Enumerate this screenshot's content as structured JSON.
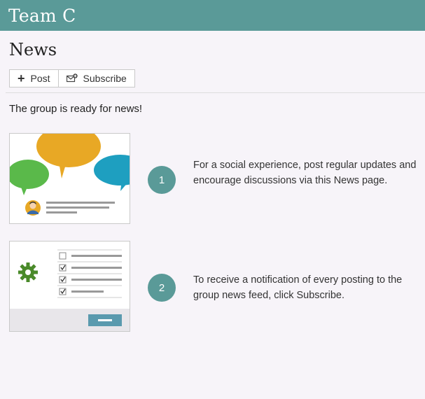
{
  "header": {
    "title": "Team C"
  },
  "page": {
    "title": "News"
  },
  "toolbar": {
    "post_label": "Post",
    "subscribe_label": "Subscribe"
  },
  "intro_text": "The group is ready for news!",
  "steps": [
    {
      "number": "1",
      "text": "For a social experience, post regular updates and encourage discussions via this News page.",
      "illustration": "speech-bubbles-illustration"
    },
    {
      "number": "2",
      "text": "To receive a notification of every posting to the group news feed, click Subscribe.",
      "illustration": "subscribe-settings-illustration"
    }
  ],
  "colors": {
    "header_bg": "#5a9a98",
    "accent": "#5a9a98",
    "bubble_orange": "#e8a825",
    "bubble_green": "#5ab94a",
    "bubble_blue": "#1e9fc0",
    "gear_green": "#4a8a2a"
  }
}
